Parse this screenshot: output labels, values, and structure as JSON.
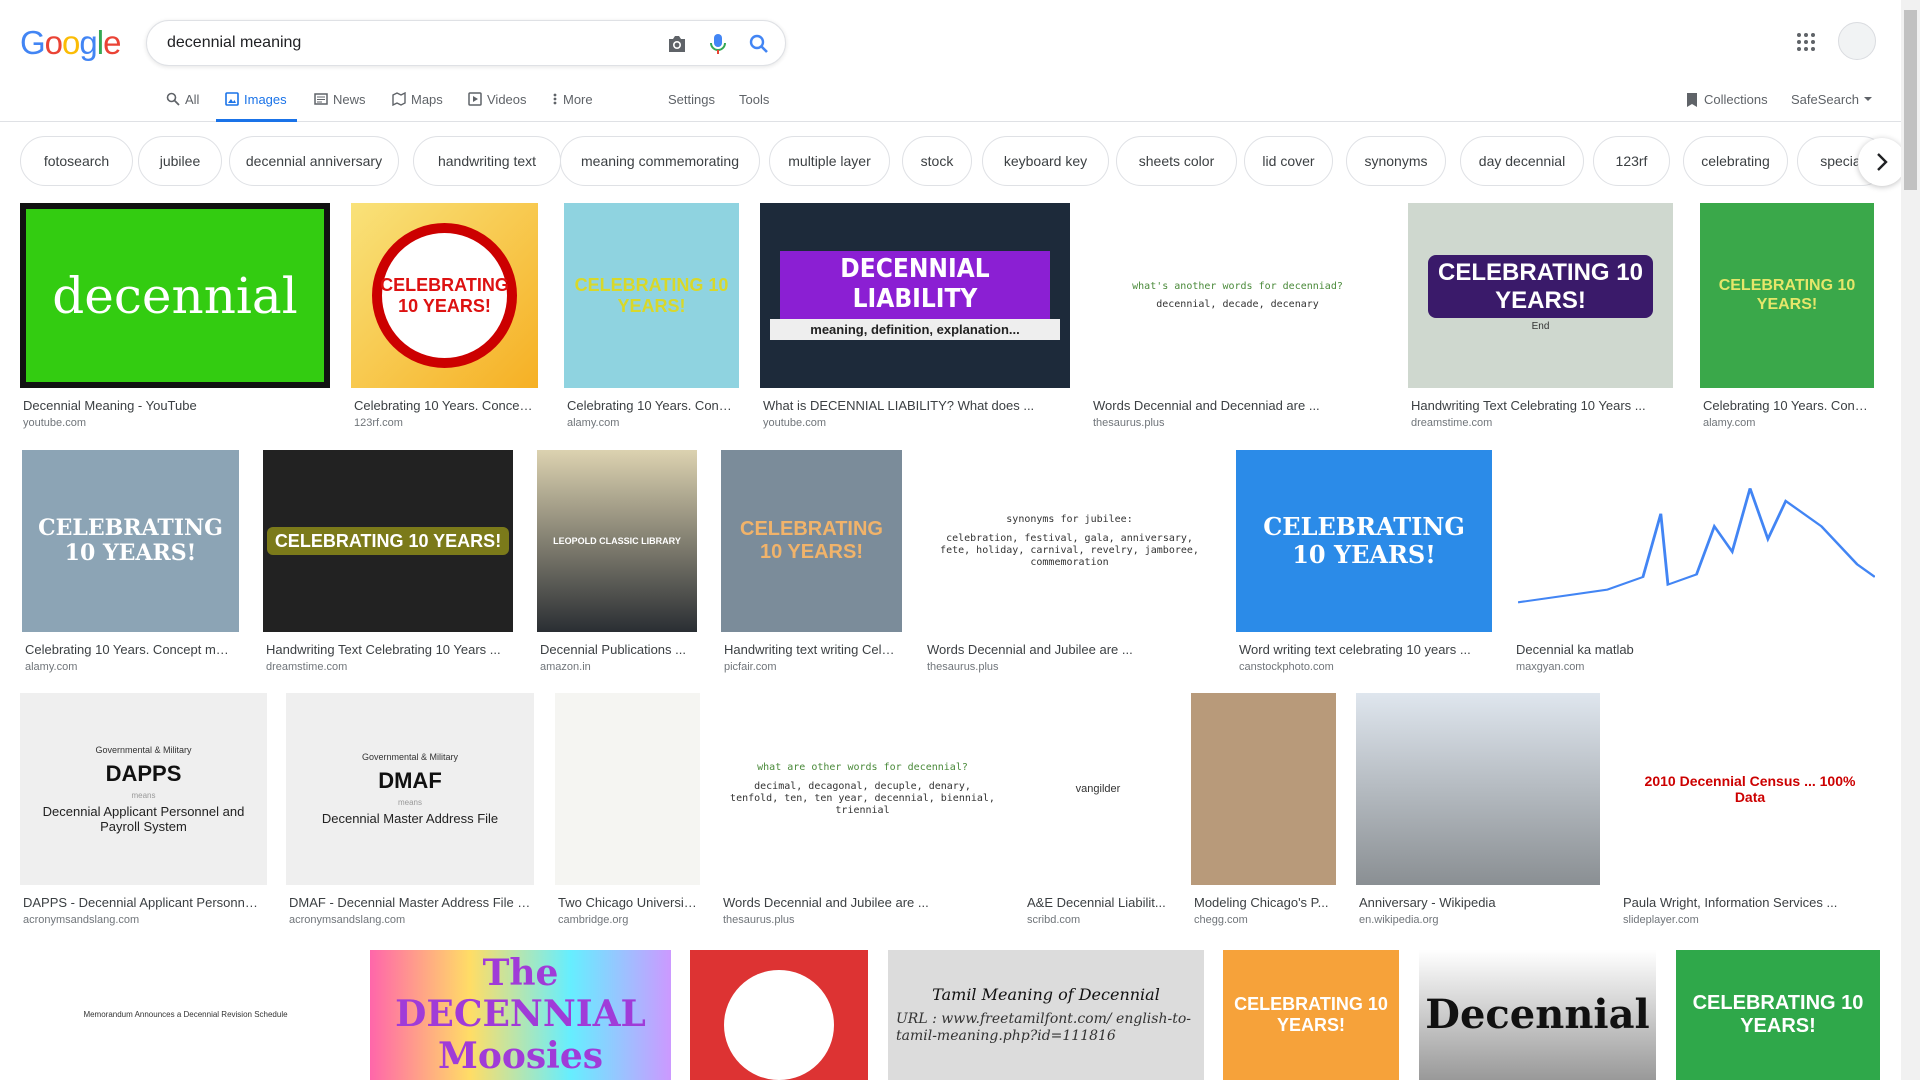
{
  "header": {
    "logo_letters": [
      "G",
      "o",
      "o",
      "g",
      "l",
      "e"
    ],
    "logo_colors": [
      "#4285F4",
      "#EA4335",
      "#FBBC05",
      "#4285F4",
      "#34A853",
      "#EA4335"
    ],
    "query": "decennial meaning",
    "icons": [
      "camera-icon",
      "microphone-icon",
      "search-icon",
      "apps-grid-icon"
    ]
  },
  "tabs": {
    "all": "All",
    "images": "Images",
    "news": "News",
    "maps": "Maps",
    "videos": "Videos",
    "more": "More",
    "settings": "Settings",
    "tools": "Tools",
    "collections": "Collections",
    "safesearch": "SafeSearch"
  },
  "chips": [
    "fotosearch",
    "jubilee",
    "decennial anniversary",
    "handwriting text",
    "meaning commemorating",
    "multiple layer",
    "stock",
    "keyboard key",
    "sheets color",
    "lid cover",
    "synonyms",
    "day decennial",
    "123rf",
    "celebrating",
    "special"
  ],
  "results": [
    {
      "title": "Decennial Meaning - YouTube",
      "source": "youtube.com",
      "thumb_text": "decennial"
    },
    {
      "title": "Celebrating 10 Years. Concept ...",
      "source": "123rf.com",
      "thumb_text": "CELEBRATING 10 YEARS!"
    },
    {
      "title": "Celebrating 10 Years. Conce...",
      "source": "alamy.com",
      "thumb_text": "CELEBRATING 10 YEARS!"
    },
    {
      "title": "What is DECENNIAL LIABILITY? What does ...",
      "source": "youtube.com",
      "thumb_text": "DECENNIAL LIABILITY",
      "thumb_sub": "meaning, definition, explanation..."
    },
    {
      "title": "Words Decennial and Decenniad are ...",
      "source": "thesaurus.plus",
      "thumb_text": "what's another words for decenniad?",
      "thumb_sub": "decennial, decade, decenary"
    },
    {
      "title": "Handwriting Text Celebrating 10 Years ...",
      "source": "dreamstime.com",
      "thumb_text": "CELEBRATING 10 YEARS!",
      "thumb_sub": "End"
    },
    {
      "title": "Celebrating 10 Years. Conce...",
      "source": "alamy.com",
      "thumb_text": "CELEBRATING 10 YEARS!"
    },
    {
      "title": "Celebrating 10 Years. Concept mea...",
      "source": "alamy.com",
      "thumb_text": "CELEBRATING 10 YEARS!"
    },
    {
      "title": "Handwriting Text Celebrating 10 Years ...",
      "source": "dreamstime.com",
      "thumb_text": "CELEBRATING 10 YEARS!"
    },
    {
      "title": "Decennial Publications ...",
      "source": "amazon.in",
      "thumb_text": "LEOPOLD CLASSIC LIBRARY"
    },
    {
      "title": "Handwriting text writing Celeb...",
      "source": "picfair.com",
      "thumb_text": "CELEBRATING 10 YEARS!"
    },
    {
      "title": "Words Decennial and Jubilee are ...",
      "source": "thesaurus.plus",
      "thumb_text": "synonyms for jubilee:",
      "thumb_sub": "celebration, festival, gala, anniversary, fete, holiday, carnival, revelry, jamboree, commemoration"
    },
    {
      "title": "Word writing text celebrating 10 years ...",
      "source": "canstockphoto.com",
      "thumb_text": "CELEBRATING 10 YEARS!"
    },
    {
      "title": "Decennial ka matlab",
      "source": "maxgyan.com",
      "thumb_text": ""
    },
    {
      "title": "DAPPS - Decennial Applicant Personnel ...",
      "source": "acronymsandslang.com",
      "thumb_text": "DAPPS",
      "thumb_sub": "Decennial Applicant Personnel and Payroll System",
      "thumb_small": "Governmental & Military",
      "thumb_means": "means"
    },
    {
      "title": "DMAF - Decennial Master Address File i...",
      "source": "acronymsandslang.com",
      "thumb_text": "DMAF",
      "thumb_sub": "Decennial Master Address File",
      "thumb_small": "Governmental & Military",
      "thumb_means": "means"
    },
    {
      "title": "Two Chicago Universit...",
      "source": "cambridge.org",
      "thumb_text": ""
    },
    {
      "title": "Words Decennial and Jubilee are ...",
      "source": "thesaurus.plus",
      "thumb_text": "what are other words for decennial?",
      "thumb_sub": "decimal, decagonal, decuple, denary, tenfold, ten, ten year, decennial, biennial, triennial"
    },
    {
      "title": "A&E Decennial Liabilit...",
      "source": "scribd.com",
      "thumb_text": "vangilder"
    },
    {
      "title": "Modeling Chicago's P...",
      "source": "chegg.com",
      "thumb_text": ""
    },
    {
      "title": "Anniversary - Wikipedia",
      "source": "en.wikipedia.org",
      "thumb_text": ""
    },
    {
      "title": "Paula Wright, Information Services ...",
      "source": "slideplayer.com",
      "thumb_text": "2010 Decennial Census ... 100% Data"
    },
    {
      "title": "",
      "source": "",
      "thumb_text": "Memorandum Announces a Decennial Revision Schedule"
    },
    {
      "title": "",
      "source": "",
      "thumb_text": "The DECENNIAL Moosies"
    },
    {
      "title": "",
      "source": "",
      "thumb_text": ""
    },
    {
      "title": "",
      "source": "",
      "thumb_text": "Tamil Meaning of Decennial",
      "thumb_sub": "URL : www.freetamilfont.com/ english-to-tamil-meaning.php?id=111816"
    },
    {
      "title": "",
      "source": "",
      "thumb_text": "CELEBRATING 10 YEARS!"
    },
    {
      "title": "",
      "source": "",
      "thumb_text": "Decennial"
    },
    {
      "title": "",
      "source": "",
      "thumb_text": "CELEBRATING 10 YEARS!"
    }
  ],
  "colors": {
    "accent": "#1a73e8",
    "text_secondary": "#70757a"
  }
}
